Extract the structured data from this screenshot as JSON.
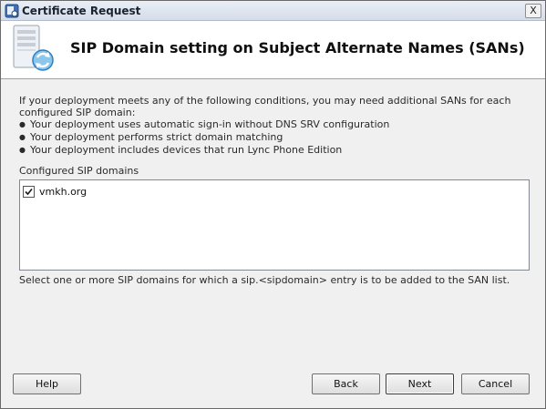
{
  "window": {
    "title": "Certificate Request",
    "close_label": "X"
  },
  "header": {
    "title": "SIP Domain setting on Subject Alternate Names (SANs)",
    "icon": "server-sync-icon"
  },
  "intro": {
    "text": "If your deployment meets any of the following conditions, you may need additional SANs for each configured SIP domain:",
    "bullets": [
      "Your deployment uses automatic sign-in without DNS SRV configuration",
      "Your deployment performs strict domain matching",
      "Your deployment includes devices that run Lync Phone Edition"
    ]
  },
  "domains": {
    "label": "Configured SIP domains",
    "items": [
      {
        "name": "vmkh.org",
        "checked": true
      }
    ]
  },
  "hint": "Select one or more SIP domains for which a sip.<sipdomain> entry is to be added to the SAN list.",
  "buttons": {
    "help": "Help",
    "back": "Back",
    "next": "Next",
    "cancel": "Cancel"
  }
}
